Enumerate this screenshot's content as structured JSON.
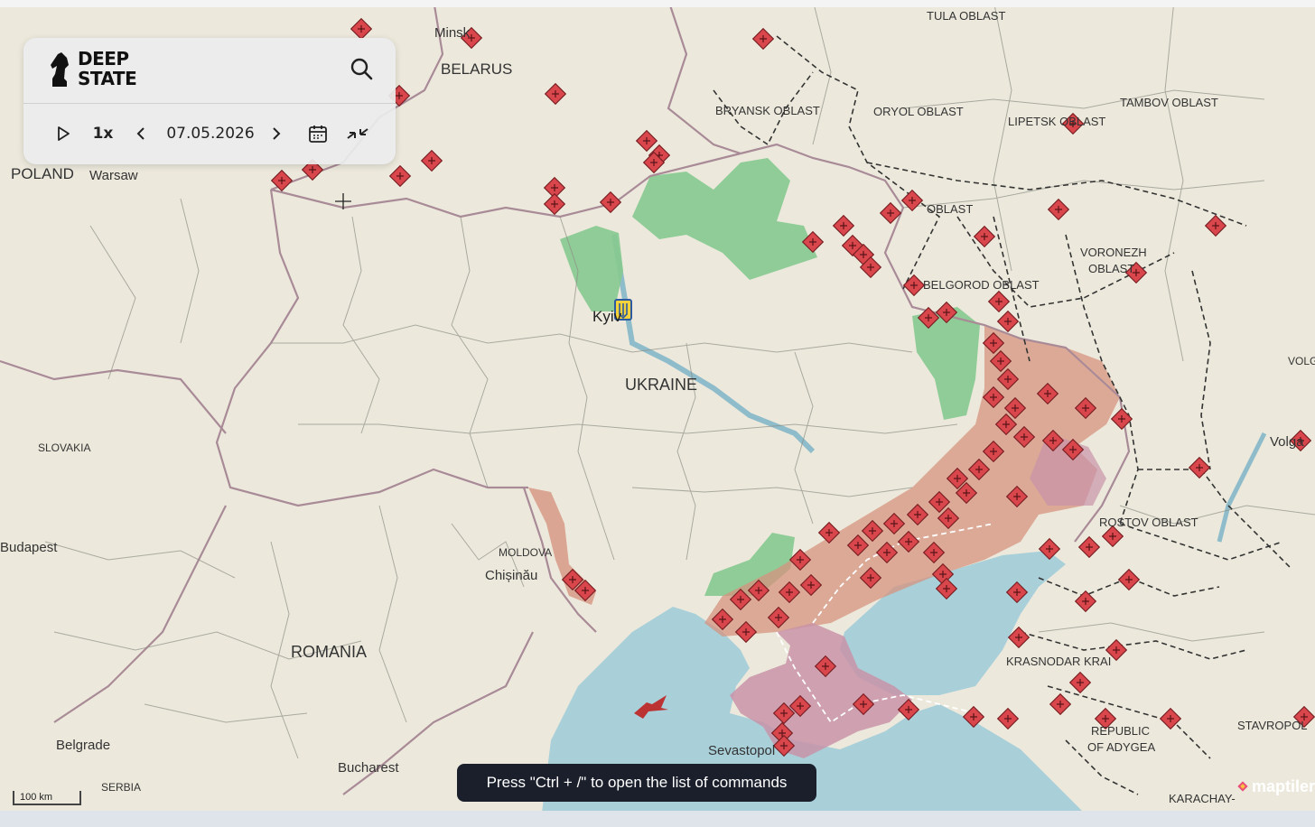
{
  "app": {
    "brand_line1": "DEEP",
    "brand_line2": "STATE",
    "icon": "knight-logo-icon"
  },
  "playback": {
    "play_icon": "play-icon",
    "speed": "1x",
    "date": "07.05.2026",
    "prev_icon": "chevron-left-icon",
    "next_icon": "chevron-right-icon",
    "calendar_icon": "calendar-icon",
    "collapse_icon": "collapse-icon"
  },
  "search": {
    "icon": "search-icon"
  },
  "tooltip": "Press \"Ctrl + /\" to open the list of commands",
  "scale": "100 km",
  "attribution": "maptiler",
  "colors": {
    "map_bg": "#ece9dc",
    "sea": "#a9cfd9",
    "occupied": "#d6937f",
    "occupied_dark": "#c993a8",
    "liberated": "#86c98f",
    "marker": "#d9474d",
    "marker_outline": "#7a1f23",
    "border": "#a98a97"
  },
  "labels": [
    {
      "id": "belarus",
      "text": "BELARUS"
    },
    {
      "id": "minsk",
      "text": "Minsk"
    },
    {
      "id": "poland",
      "text": "POLAND"
    },
    {
      "id": "warsaw",
      "text": "Warsaw"
    },
    {
      "id": "ukraine",
      "text": "UKRAINE"
    },
    {
      "id": "kyiv",
      "text": "Kyiv"
    },
    {
      "id": "tula",
      "text": "TULA OBLAST"
    },
    {
      "id": "bryansk",
      "text": "BRYANSK OBLAST"
    },
    {
      "id": "oryol",
      "text": "ORYOL OBLAST"
    },
    {
      "id": "lipetsk",
      "text": "LIPETSK OBLAST"
    },
    {
      "id": "tambov",
      "text": "TAMBOV OBLAST"
    },
    {
      "id": "kursk",
      "text": "OBLAST"
    },
    {
      "id": "voronezh1",
      "text": "VORONEZH"
    },
    {
      "id": "voronezh2",
      "text": "OBLAST"
    },
    {
      "id": "belgorod",
      "text": "BELGOROD OBLAST"
    },
    {
      "id": "slovakia",
      "text": "SLOVAKIA"
    },
    {
      "id": "budapest",
      "text": "Budapest"
    },
    {
      "id": "moldova",
      "text": "MOLDOVA"
    },
    {
      "id": "chisinau",
      "text": "Chișinău"
    },
    {
      "id": "romania",
      "text": "ROMANIA"
    },
    {
      "id": "belgrade",
      "text": "Belgrade"
    },
    {
      "id": "serbia",
      "text": "SERBIA"
    },
    {
      "id": "bucharest",
      "text": "Bucharest"
    },
    {
      "id": "sevastopol",
      "text": "Sevastopol"
    },
    {
      "id": "rostov",
      "text": "ROSTOV OBLAST"
    },
    {
      "id": "krasnodar",
      "text": "KRASNODAR KRAI"
    },
    {
      "id": "adygea1",
      "text": "REPUBLIC"
    },
    {
      "id": "adygea2",
      "text": "OF ADYGEA"
    },
    {
      "id": "stavropol",
      "text": "STAVROPOL"
    },
    {
      "id": "karachay",
      "text": "KARACHAY-"
    },
    {
      "id": "volgograd",
      "text": "VOLGOGRAD"
    },
    {
      "id": "volga",
      "text": "Volga"
    }
  ]
}
